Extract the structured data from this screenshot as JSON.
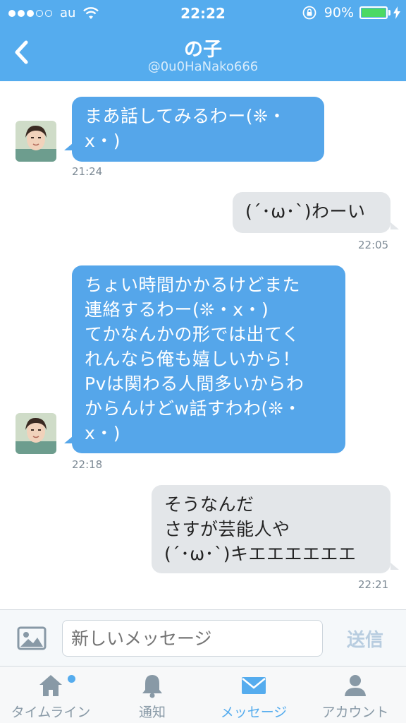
{
  "status_bar": {
    "carrier": "au",
    "time": "22:22",
    "battery": "90%",
    "battery_level": 0.9,
    "signal_bars_filled": 3,
    "signal_bars_total": 5
  },
  "header": {
    "title": "の子",
    "handle": "@0u0HaNako666",
    "back_icon": "chevron-left-icon"
  },
  "messages": [
    {
      "direction": "incoming",
      "lines": [
        "まあ話してみるわー(❊・",
        "x・)"
      ],
      "time": "21:24"
    },
    {
      "direction": "outgoing",
      "lines": [
        "(´･ω･`)わーい"
      ],
      "time": "22:05"
    },
    {
      "direction": "incoming",
      "lines": [
        "ちょい時間かかるけどまた",
        "連絡するわー(❊・x・)",
        "てかなんかの形では出てく",
        "れんなら俺も嬉しいから！",
        "Pvは関わる人間多いからわ",
        "からんけどw話すわわ(❊・",
        "x・)"
      ],
      "time": "22:18"
    },
    {
      "direction": "outgoing",
      "lines": [
        "そうなんだ",
        "さすが芸能人や",
        "(´･ω･`)キエエエエエエ"
      ],
      "time": "22:21"
    }
  ],
  "composer": {
    "placeholder": "新しいメッセージ",
    "send_label": "送信",
    "photo_icon": "photo-icon"
  },
  "tabs": [
    {
      "label": "タイムライン",
      "icon": "home-icon",
      "active": false,
      "has_badge": true
    },
    {
      "label": "通知",
      "icon": "bell-icon",
      "active": false,
      "has_badge": false
    },
    {
      "label": "メッセージ",
      "icon": "envelope-icon",
      "active": true,
      "has_badge": false
    },
    {
      "label": "アカウント",
      "icon": "person-icon",
      "active": false,
      "has_badge": false
    }
  ],
  "colors": {
    "brand_blue": "#55acee",
    "incoming_bubble": "#55a6ea",
    "outgoing_bubble": "#e3e6e9",
    "battery_green": "#4cd964"
  }
}
